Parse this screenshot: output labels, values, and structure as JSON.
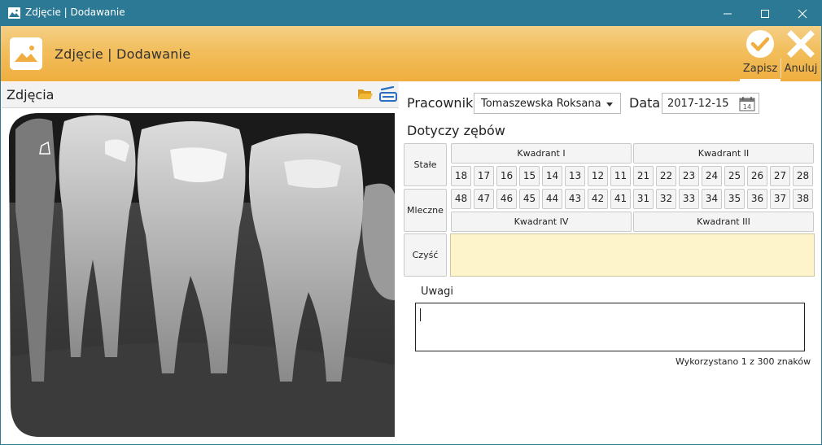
{
  "window": {
    "title": "Zdjęcie | Dodawanie"
  },
  "header": {
    "title": "Zdjęcie | Dodawanie",
    "save_label": "Zapisz",
    "cancel_label": "Anuluj"
  },
  "left": {
    "title": "Zdjęcia"
  },
  "form": {
    "employee_label": "Pracownik",
    "employee_value": "Tomaszewska Roksana",
    "date_label": "Data",
    "date_value": "2017-12-15",
    "calendar_day": "14",
    "teeth_label": "Dotyczy zębów"
  },
  "teeth": {
    "row_permanent": "Stałe",
    "row_milk": "Mleczne",
    "row_clear": "Czyść",
    "quadrant_1": "Kwadrant I",
    "quadrant_2": "Kwadrant II",
    "quadrant_3": "Kwadrant III",
    "quadrant_4": "Kwadrant IV",
    "upper": [
      "18",
      "17",
      "16",
      "15",
      "14",
      "13",
      "12",
      "11",
      "21",
      "22",
      "23",
      "24",
      "25",
      "26",
      "27",
      "28"
    ],
    "lower": [
      "48",
      "47",
      "46",
      "45",
      "44",
      "43",
      "42",
      "41",
      "31",
      "32",
      "33",
      "34",
      "35",
      "36",
      "37",
      "38"
    ]
  },
  "notes": {
    "label": "Uwagi",
    "value": "",
    "counter": "Wykorzystano 1 z 300 znaków"
  },
  "colors": {
    "titlebar": "#2b7995",
    "header": "#f2be5c",
    "selection_area": "#fdf4cc"
  }
}
